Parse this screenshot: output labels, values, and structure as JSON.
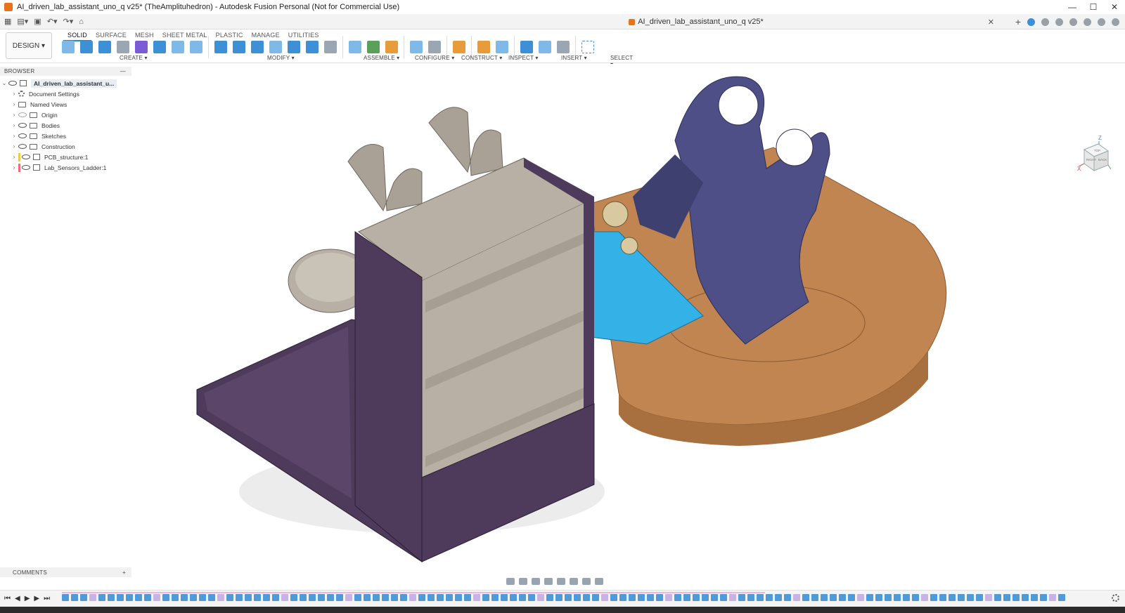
{
  "window": {
    "title": "AI_driven_lab_assistant_uno_q v25* (TheAmplituhedron) - Autodesk Fusion Personal (Not for Commercial Use)",
    "controls": [
      "—",
      "☐",
      "✕"
    ]
  },
  "doc_tab": {
    "label": "AI_driven_lab_assistant_uno_q v25*",
    "close": "✕"
  },
  "workspace": {
    "label": "DESIGN ▾"
  },
  "ribbon": {
    "tabs": [
      "SOLID",
      "SURFACE",
      "MESH",
      "SHEET METAL",
      "PLASTIC",
      "MANAGE",
      "UTILITIES"
    ],
    "active_tab": "SOLID",
    "groups": [
      "CREATE ▾",
      "MODIFY ▾",
      "ASSEMBLE ▾",
      "CONFIGURE ▾",
      "CONSTRUCT ▾",
      "INSPECT ▾",
      "INSERT ▾",
      "SELECT ▾"
    ]
  },
  "browser": {
    "title": "BROWSER",
    "collapse": "—",
    "root": "AI_driven_lab_assistant_u...",
    "items": [
      {
        "label": "Document Settings",
        "icon": "gear-icon"
      },
      {
        "label": "Named Views",
        "icon": "folder-icon"
      },
      {
        "label": "Origin",
        "icon": "folder-icon"
      },
      {
        "label": "Bodies",
        "icon": "folder-icon"
      },
      {
        "label": "Sketches",
        "icon": "folder-icon"
      },
      {
        "label": "Construction",
        "icon": "folder-icon"
      },
      {
        "label": "PCB_structure:1",
        "icon": "component-icon",
        "strip": "#f2c94c"
      },
      {
        "label": "Lab_Sensors_Ladder:1",
        "icon": "component-icon",
        "strip": "#eb6e7a"
      }
    ]
  },
  "comments": {
    "title": "COMMENTS",
    "add": "+"
  },
  "viewcube": {
    "axis_z": "Z",
    "axis_x": "X",
    "face_left": "RIGHT",
    "face_back": "BACK",
    "face_top": "TOP"
  },
  "colors": {
    "accent": "#0696d7",
    "purple_body": "#4e3a5a",
    "cream_body": "#b8b0a4",
    "navy_body": "#4d4f86",
    "wood_base": "#c18552",
    "pcb_blue": "#34b1e6"
  }
}
